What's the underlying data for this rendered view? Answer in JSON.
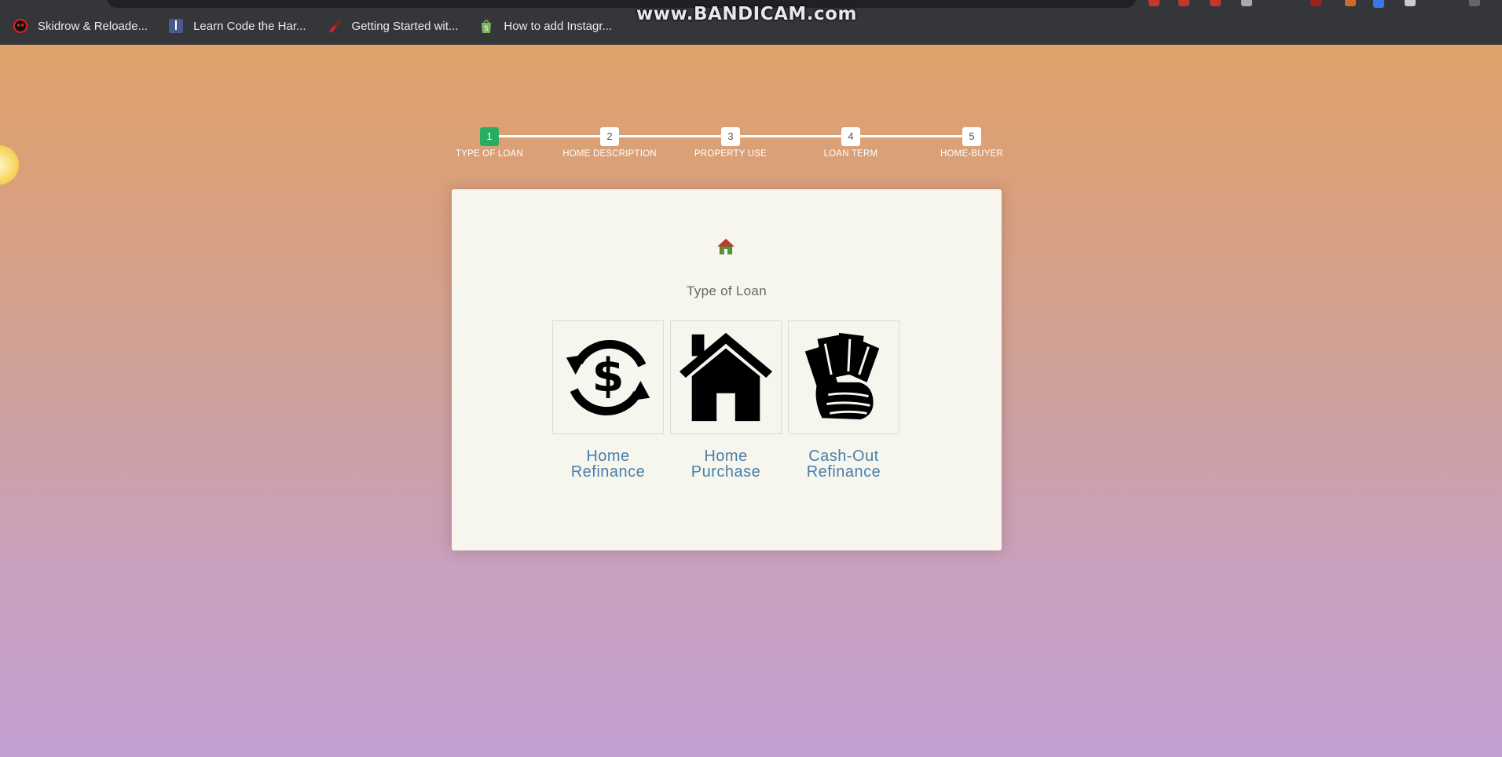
{
  "browser": {
    "watermark": "www.BANDICAM.com",
    "bookmarks": [
      {
        "label": "Skidrow & Reloade...",
        "icon": "skull-icon"
      },
      {
        "label": "Learn Code the Har...",
        "icon": "book-icon"
      },
      {
        "label": "Getting Started wit...",
        "icon": "guitar-icon"
      },
      {
        "label": "How to add Instagr...",
        "icon": "shopify-bag-icon"
      }
    ]
  },
  "stepper": {
    "steps": [
      {
        "number": "1",
        "label": "TYPE OF LOAN",
        "active": true
      },
      {
        "number": "2",
        "label": "HOME DESCRIPTION",
        "active": false
      },
      {
        "number": "3",
        "label": "PROPERTY USE",
        "active": false
      },
      {
        "number": "4",
        "label": "LOAN TERM",
        "active": false
      },
      {
        "number": "5",
        "label": "HOME-BUYER",
        "active": false
      }
    ],
    "active_color": "#27ae60"
  },
  "card": {
    "icon": "home-icon",
    "title": "Type of Loan",
    "options": [
      {
        "label_line1": "Home",
        "label_line2": "Refinance",
        "icon": "dollar-refresh-icon"
      },
      {
        "label_line1": "Home",
        "label_line2": "Purchase",
        "icon": "house-icon"
      },
      {
        "label_line1": "Cash-Out",
        "label_line2": "Refinance",
        "icon": "cash-in-hand-icon"
      }
    ],
    "label_color": "#4a7fa7"
  }
}
